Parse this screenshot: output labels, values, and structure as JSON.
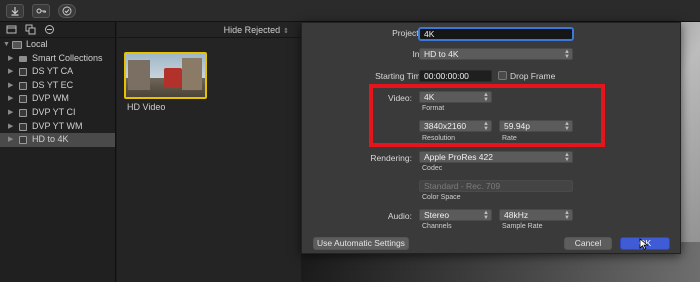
{
  "toolbar": {
    "buttons": [
      {
        "icon": "import-icon"
      },
      {
        "icon": "keyword-icon"
      },
      {
        "icon": "checkmark-icon"
      }
    ]
  },
  "sidebar": {
    "top_icons": [
      "libraries-icon",
      "photos-icon",
      "titles-icon"
    ],
    "local_label": "Local",
    "items": [
      {
        "label": "Smart Collections",
        "icon": "folder-icon"
      },
      {
        "label": "DS YT CA",
        "icon": "event-icon"
      },
      {
        "label": "DS YT EC",
        "icon": "event-icon"
      },
      {
        "label": "DVP WM",
        "icon": "event-icon"
      },
      {
        "label": "DVP YT CI",
        "icon": "event-icon"
      },
      {
        "label": "DVP YT WM",
        "icon": "event-icon"
      },
      {
        "label": "HD to 4K",
        "icon": "event-icon",
        "selected": true
      }
    ]
  },
  "browser": {
    "filter_label": "Hide Rejected",
    "clip_label": "HD Video"
  },
  "dialog": {
    "project_name_label": "Project Name:",
    "project_name_value": "4K",
    "in_event_label": "In Event:",
    "in_event_value": "HD to 4K",
    "starting_timecode_label": "Starting Timecode:",
    "starting_timecode_value": "00:00:00:00",
    "drop_frame_label": "Drop Frame",
    "video_label": "Video:",
    "format_value": "4K",
    "format_sub": "Format",
    "resolution_value": "3840x2160",
    "resolution_sub": "Resolution",
    "rate_value": "59.94p",
    "rate_sub": "Rate",
    "rendering_label": "Rendering:",
    "codec_value": "Apple ProRes 422",
    "codec_sub": "Codec",
    "color_space_value": "Standard - Rec. 709",
    "color_space_sub": "Color Space",
    "audio_label": "Audio:",
    "channels_value": "Stereo",
    "channels_sub": "Channels",
    "sample_rate_value": "48kHz",
    "sample_rate_sub": "Sample Rate",
    "use_automatic_label": "Use Automatic Settings",
    "cancel_label": "Cancel",
    "ok_label": "OK"
  },
  "colors": {
    "highlight_box": "#e8141c",
    "primary_button": "#3f5bd6",
    "thumbnail_border": "#e6c200"
  }
}
